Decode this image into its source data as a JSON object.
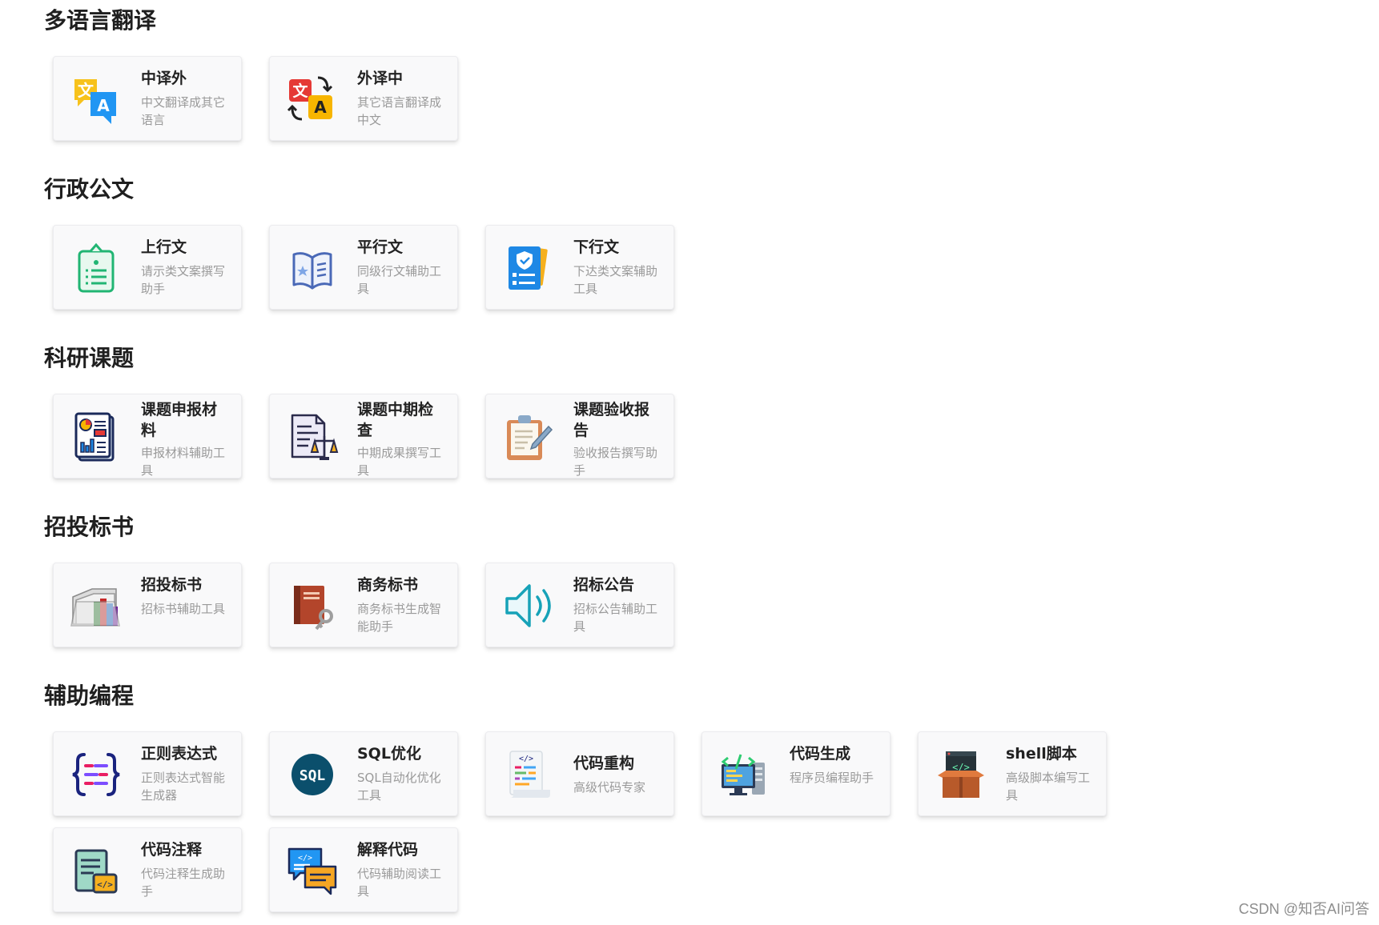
{
  "sections": [
    {
      "title": "多语言翻译",
      "cards": [
        {
          "title": "中译外",
          "desc": "中文翻译成其它语言",
          "icon": "zh-to-foreign-icon"
        },
        {
          "title": "外译中",
          "desc": "其它语言翻译成中文",
          "icon": "foreign-to-zh-icon"
        }
      ]
    },
    {
      "title": "行政公文",
      "cards": [
        {
          "title": "上行文",
          "desc": "请示类文案撰写助手",
          "icon": "clipboard-list-icon"
        },
        {
          "title": "平行文",
          "desc": "同级行文辅助工具",
          "icon": "open-book-icon"
        },
        {
          "title": "下行文",
          "desc": "下达类文案辅助工具",
          "icon": "checklist-shield-icon"
        }
      ]
    },
    {
      "title": "科研课题",
      "cards": [
        {
          "title": "课题申报材料",
          "desc": "申报材料辅助工具",
          "icon": "report-chart-icon"
        },
        {
          "title": "课题中期检查",
          "desc": "中期成果撰写工具",
          "icon": "document-scale-icon"
        },
        {
          "title": "课题验收报告",
          "desc": "验收报告撰写助手",
          "icon": "clipboard-pen-icon"
        }
      ]
    },
    {
      "title": "招投标书",
      "cards": [
        {
          "title": "招投标书",
          "desc": "招标书辅助工具",
          "icon": "folder-books-icon"
        },
        {
          "title": "商务标书",
          "desc": "商务标书生成智能助手",
          "icon": "book-key-icon"
        },
        {
          "title": "招标公告",
          "desc": "招标公告辅助工具",
          "icon": "speaker-icon"
        }
      ]
    },
    {
      "title": "辅助编程",
      "cards": [
        {
          "title": "正则表达式",
          "desc": "正则表达式智能生成器",
          "icon": "regex-braces-icon"
        },
        {
          "title": "SQL优化",
          "desc": "SQL自动化优化工具",
          "icon": "sql-badge-icon"
        },
        {
          "title": "代码重构",
          "desc": "高级代码专家",
          "icon": "code-scroll-icon"
        },
        {
          "title": "代码生成",
          "desc": "程序员编程助手",
          "icon": "computer-server-icon"
        },
        {
          "title": "shell脚本",
          "desc": "高级脚本编写工具",
          "icon": "code-box-icon"
        },
        {
          "title": "代码注释",
          "desc": "代码注释生成助手",
          "icon": "code-note-icon"
        },
        {
          "title": "解释代码",
          "desc": "代码辅助阅读工具",
          "icon": "code-chat-icon"
        }
      ]
    }
  ],
  "watermark": "CSDN @知否AI问答",
  "colors": {
    "card_bg": "#f9f9fa",
    "title": "#222222",
    "desc": "#9a9a9a"
  }
}
